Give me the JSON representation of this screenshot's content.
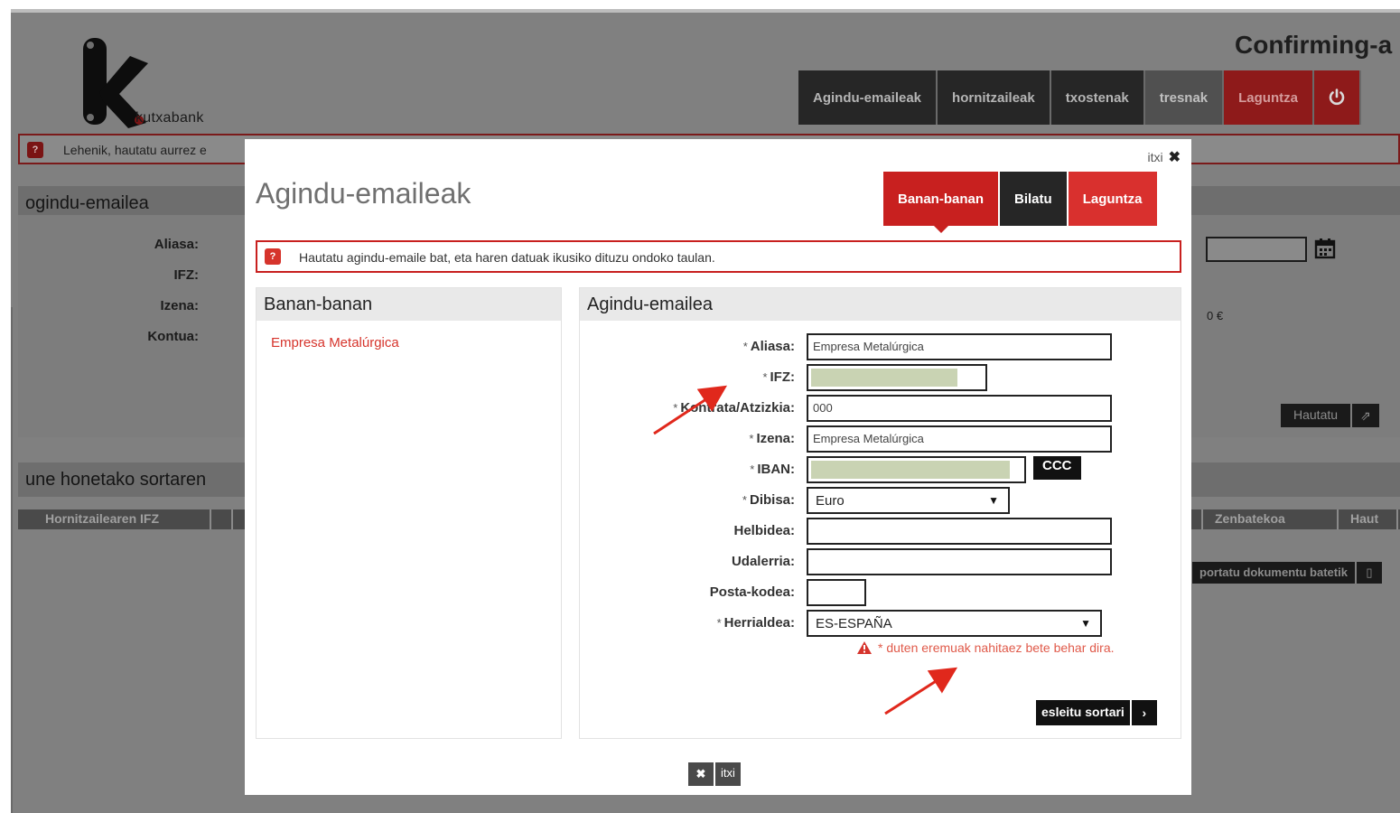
{
  "header": {
    "logo_text": "kutxabank",
    "app_title": "Confirming-a",
    "nav": [
      {
        "label": "Agindu-emaileak"
      },
      {
        "label": "hornitzaileak"
      },
      {
        "label": "txostenak"
      },
      {
        "label": "tresnak"
      },
      {
        "label": "Laguntza"
      }
    ],
    "power_icon": "power-icon"
  },
  "background": {
    "notice": "Lehenik, hautatu aurrez e",
    "panel1_title": "ogindu-emailea",
    "labels": {
      "aliasa": "Aliasa:",
      "ifz": "IFZ:",
      "izena": "Izena:",
      "kontua": "Kontua:"
    },
    "amount": "0 €",
    "hautatu_label": "Hautatu",
    "panel2_title": "une honetako sortaren",
    "table_headers": {
      "ifz": "Hornitzailearen IFZ",
      "zenbatekoa": "Zenbatekoa",
      "haut": "Haut"
    },
    "import_label": "portatu dokumentu batetik"
  },
  "modal": {
    "close_top": "itxi",
    "title": "Agindu-emaileak",
    "tabs": [
      {
        "label": "Banan-banan"
      },
      {
        "label": "Bilatu"
      },
      {
        "label": "Laguntza"
      }
    ],
    "notice": "Hautatu agindu-emaile bat, eta haren datuak ikusiko dituzu ondoko taulan.",
    "left_panel": {
      "title": "Banan-banan",
      "entries": [
        "Empresa Metalúrgica"
      ]
    },
    "right_panel": {
      "title": "Agindu-emailea",
      "fields": {
        "aliasa": {
          "label": "Aliasa:",
          "value": "Empresa Metalúrgica"
        },
        "ifz": {
          "label": "IFZ:"
        },
        "kontrata": {
          "label": "Kontrata/Atzizkia:",
          "value": "000"
        },
        "izena": {
          "label": "Izena:",
          "value": "Empresa Metalúrgica"
        },
        "iban": {
          "label": "IBAN:"
        },
        "dibisa": {
          "label": "Dibisa:",
          "value": "Euro"
        },
        "helbidea": {
          "label": "Helbidea:",
          "value": ""
        },
        "udalerria": {
          "label": "Udalerria:",
          "value": ""
        },
        "posta": {
          "label": "Posta-kodea:",
          "value": ""
        },
        "herrialdea": {
          "label": "Herrialdea:",
          "value": "ES-ESPAÑA"
        }
      },
      "required_mark": "*",
      "ccc_label": "CCC",
      "required_note": "* duten eremuak nahitaez bete behar dira.",
      "assign_label": "esleitu sortari"
    },
    "close_bottom": "itxi"
  },
  "colors": {
    "brand_red": "#c8201f",
    "dark": "#262626",
    "masked_fill": "#c9d3b3",
    "annotation": "#e0281c"
  }
}
